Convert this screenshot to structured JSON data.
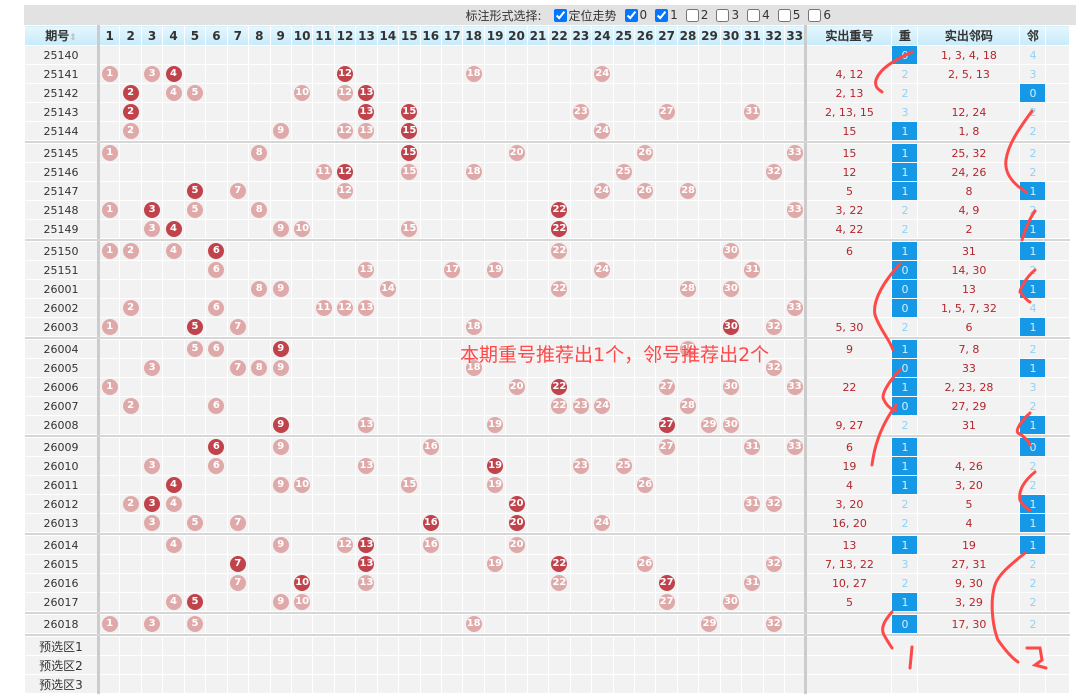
{
  "toolbar": {
    "label": "标注形式选择:",
    "checks": [
      {
        "label": "定位走势",
        "checked": true
      },
      {
        "label": "0",
        "checked": true
      },
      {
        "label": "1",
        "checked": true
      },
      {
        "label": "2",
        "checked": false
      },
      {
        "label": "3",
        "checked": false
      },
      {
        "label": "4",
        "checked": false
      },
      {
        "label": "5",
        "checked": false
      },
      {
        "label": "6",
        "checked": false
      }
    ]
  },
  "headers": {
    "period": "期号",
    "repeat_numbers": "实出重号",
    "repeat_count": "重",
    "neighbor_numbers": "实出邻码",
    "neighbor_count": "邻"
  },
  "columns": [
    "1",
    "2",
    "3",
    "4",
    "5",
    "6",
    "7",
    "8",
    "9",
    "10",
    "11",
    "12",
    "13",
    "14",
    "15",
    "16",
    "17",
    "18",
    "19",
    "20",
    "21",
    "22",
    "23",
    "24",
    "25",
    "26",
    "27",
    "28",
    "29",
    "30",
    "31",
    "32",
    "33"
  ],
  "groups": [
    [
      {
        "p": "25140",
        "n": [],
        "r": "",
        "rc": "0",
        "nb": "1, 3, 4, 18",
        "nc": "4"
      },
      {
        "p": "25141",
        "n": [
          1,
          3,
          4,
          12,
          18,
          24
        ],
        "r": "4, 12",
        "rc": "2",
        "nb": "2, 5, 13",
        "nc": "3"
      },
      {
        "p": "25142",
        "n": [
          2,
          4,
          5,
          10,
          12,
          13
        ],
        "r": "2, 13",
        "rc": "2",
        "nb": "",
        "nc": "0"
      },
      {
        "p": "25143",
        "n": [
          2,
          13,
          15,
          23,
          27,
          31
        ],
        "r": "2, 13, 15",
        "rc": "3",
        "nb": "12, 24",
        "nc": "2"
      },
      {
        "p": "25144",
        "n": [
          2,
          9,
          12,
          13,
          15,
          24
        ],
        "r": "15",
        "rc": "1",
        "nb": "1, 8",
        "nc": "2"
      }
    ],
    [
      {
        "p": "25145",
        "n": [
          1,
          8,
          15,
          20,
          26,
          33
        ],
        "r": "15",
        "rc": "1",
        "nb": "25, 32",
        "nc": "2"
      },
      {
        "p": "25146",
        "n": [
          11,
          12,
          15,
          18,
          25,
          32
        ],
        "r": "12",
        "rc": "1",
        "nb": "24, 26",
        "nc": "2"
      },
      {
        "p": "25147",
        "n": [
          5,
          7,
          12,
          24,
          26,
          28
        ],
        "r": "5",
        "rc": "1",
        "nb": "8",
        "nc": "1"
      },
      {
        "p": "25148",
        "n": [
          1,
          3,
          5,
          8,
          22,
          33
        ],
        "r": "3, 22",
        "rc": "2",
        "nb": "4, 9",
        "nc": "2"
      },
      {
        "p": "25149",
        "n": [
          3,
          4,
          9,
          10,
          15,
          22
        ],
        "r": "4, 22",
        "rc": "2",
        "nb": "2",
        "nc": "1"
      }
    ],
    [
      {
        "p": "25150",
        "n": [
          1,
          2,
          4,
          6,
          22,
          30
        ],
        "r": "6",
        "rc": "1",
        "nb": "31",
        "nc": "1"
      },
      {
        "p": "25151",
        "n": [
          6,
          13,
          17,
          19,
          24,
          31
        ],
        "r": "",
        "rc": "0",
        "nb": "14, 30",
        "nc": "2"
      },
      {
        "p": "26001",
        "n": [
          8,
          9,
          14,
          22,
          28,
          30
        ],
        "r": "",
        "rc": "0",
        "nb": "13",
        "nc": "1"
      },
      {
        "p": "26002",
        "n": [
          2,
          6,
          11,
          12,
          13,
          33
        ],
        "r": "",
        "rc": "0",
        "nb": "1, 5, 7, 32",
        "nc": "4"
      },
      {
        "p": "26003",
        "n": [
          1,
          5,
          7,
          18,
          30,
          32
        ],
        "r": "5, 30",
        "rc": "2",
        "nb": "6",
        "nc": "1"
      }
    ],
    [
      {
        "p": "26004",
        "n": [
          5,
          6,
          9,
          28
        ],
        "r": "9",
        "rc": "1",
        "nb": "7, 8",
        "nc": "2"
      },
      {
        "p": "26005",
        "n": [
          3,
          7,
          8,
          9,
          18,
          32
        ],
        "r": "",
        "rc": "0",
        "nb": "33",
        "nc": "1"
      },
      {
        "p": "26006",
        "n": [
          1,
          20,
          22,
          27,
          30,
          33
        ],
        "r": "22",
        "rc": "1",
        "nb": "2, 23, 28",
        "nc": "3"
      },
      {
        "p": "26007",
        "n": [
          2,
          6,
          22,
          23,
          24,
          28
        ],
        "r": "",
        "rc": "0",
        "nb": "27, 29",
        "nc": "2"
      },
      {
        "p": "26008",
        "n": [
          9,
          13,
          19,
          27,
          29,
          30
        ],
        "r": "9, 27",
        "rc": "2",
        "nb": "31",
        "nc": "1"
      }
    ],
    [
      {
        "p": "26009",
        "n": [
          6,
          9,
          16,
          27,
          31,
          33
        ],
        "r": "6",
        "rc": "1",
        "nb": "",
        "nc": "0"
      },
      {
        "p": "26010",
        "n": [
          3,
          6,
          13,
          19,
          23,
          25
        ],
        "r": "19",
        "rc": "1",
        "nb": "4, 26",
        "nc": "2"
      },
      {
        "p": "26011",
        "n": [
          4,
          9,
          10,
          15,
          19,
          26
        ],
        "r": "4",
        "rc": "1",
        "nb": "3, 20",
        "nc": "2"
      },
      {
        "p": "26012",
        "n": [
          2,
          3,
          4,
          20,
          31,
          32
        ],
        "r": "3, 20",
        "rc": "2",
        "nb": "5",
        "nc": "1"
      },
      {
        "p": "26013",
        "n": [
          3,
          5,
          7,
          16,
          20,
          24
        ],
        "r": "16, 20",
        "rc": "2",
        "nb": "4",
        "nc": "1"
      }
    ],
    [
      {
        "p": "26014",
        "n": [
          4,
          9,
          12,
          13,
          16,
          20
        ],
        "r": "13",
        "rc": "1",
        "nb": "19",
        "nc": "1"
      },
      {
        "p": "26015",
        "n": [
          7,
          13,
          19,
          22,
          26,
          32
        ],
        "r": "7, 13, 22",
        "rc": "3",
        "nb": "27, 31",
        "nc": "2"
      },
      {
        "p": "26016",
        "n": [
          7,
          10,
          13,
          22,
          27,
          31
        ],
        "r": "10, 27",
        "rc": "2",
        "nb": "9, 30",
        "nc": "2"
      },
      {
        "p": "26017",
        "n": [
          4,
          5,
          9,
          10,
          27,
          30
        ],
        "r": "5",
        "rc": "1",
        "nb": "3, 29",
        "nc": "2"
      }
    ],
    [
      {
        "p": "26018",
        "n": [
          1,
          3,
          5,
          18,
          29,
          32
        ],
        "r": "",
        "rc": "0",
        "nb": "17, 30",
        "nc": "2"
      }
    ]
  ],
  "preselect": [
    "预选区1",
    "预选区2",
    "预选区3"
  ],
  "annotation": "本期重号推荐出1个，邻号推荐出2个",
  "colors": {
    "ball": "#e0a9a9",
    "repeat_ball": "#c0434b",
    "highlight": "#1598e6",
    "ink": "#ff4848"
  }
}
